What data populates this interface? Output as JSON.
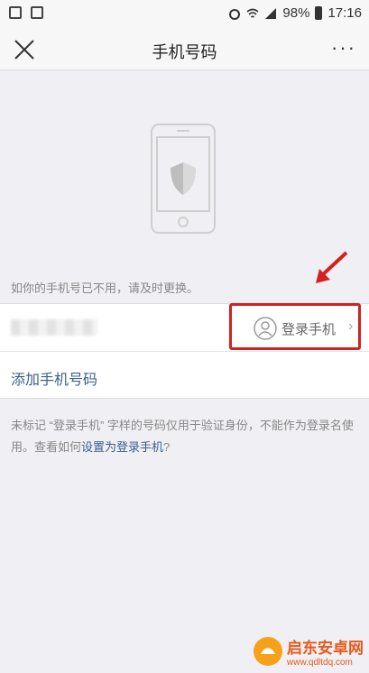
{
  "statusbar": {
    "battery": "98%",
    "time": "17:16"
  },
  "navbar": {
    "title": "手机号码",
    "more": "···"
  },
  "hint": "如你的手机号已不用，请及时更换。",
  "phone_row": {
    "login_label": "登录手机"
  },
  "add_phone": "添加手机号码",
  "note": {
    "part1": "未标记 “登录手机” 字样的号码仅用于验证身份，不能作为登录名使用。查看如何",
    "link": "设置为登录手机",
    "part2": "?"
  },
  "watermark": {
    "name": "启东安卓网",
    "url": "www.qdltdq.com"
  },
  "colors": {
    "highlight": "#d32020",
    "link": "#3b5f8a",
    "background": "#efeff4"
  }
}
